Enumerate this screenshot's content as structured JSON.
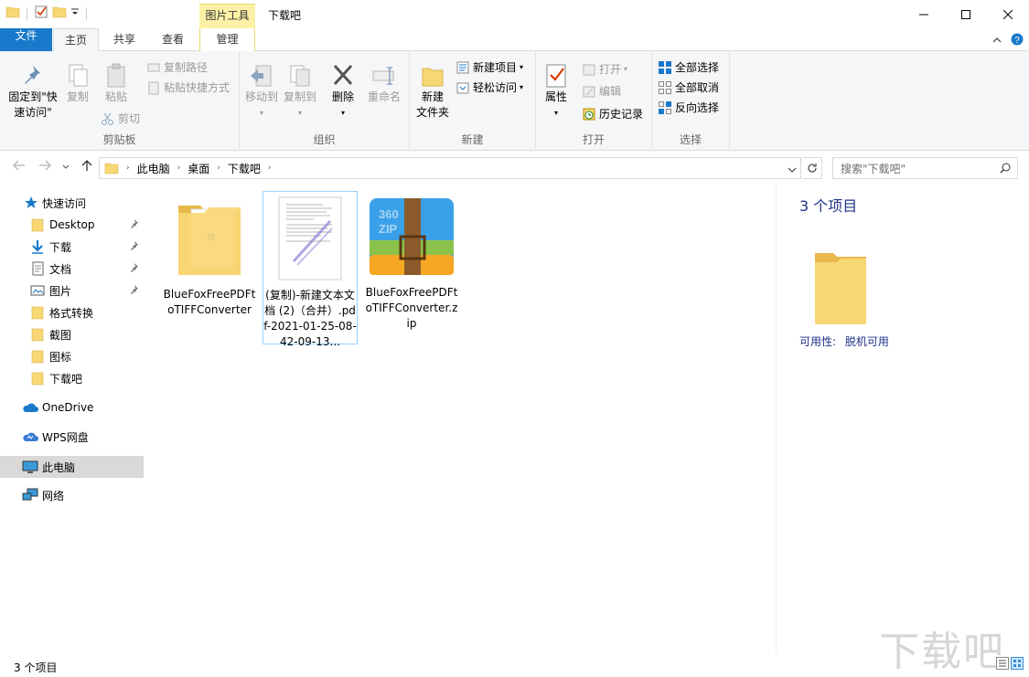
{
  "window": {
    "title": "下载吧",
    "contextual_tab_header": "图片工具"
  },
  "tabs": {
    "file": "文件",
    "home": "主页",
    "share": "共享",
    "view": "查看",
    "manage": "管理"
  },
  "ribbon": {
    "clipboard": {
      "label": "剪贴板",
      "pin": "固定到\"快\n速访问\"",
      "copy": "复制",
      "paste": "粘贴",
      "copy_path": "复制路径",
      "paste_shortcut": "粘贴快捷方式",
      "cut": "剪切"
    },
    "organize": {
      "label": "组织",
      "move_to": "移动到",
      "copy_to": "复制到",
      "delete": "删除",
      "rename": "重命名"
    },
    "new": {
      "label": "新建",
      "new_folder": "新建\n文件夹",
      "new_item": "新建项目",
      "easy_access": "轻松访问"
    },
    "open": {
      "label": "打开",
      "properties": "属性",
      "open": "打开",
      "edit": "编辑",
      "history": "历史记录"
    },
    "select": {
      "label": "选择",
      "select_all": "全部选择",
      "select_none": "全部取消",
      "invert": "反向选择"
    }
  },
  "address": {
    "crumbs": [
      "此电脑",
      "桌面",
      "下载吧"
    ],
    "search_placeholder": "搜索\"下载吧\""
  },
  "nav": {
    "quick_access": "快速访问",
    "items": [
      "Desktop",
      "下载",
      "文档",
      "图片",
      "格式转换",
      "截图",
      "图标",
      "下载吧"
    ],
    "onedrive": "OneDrive",
    "wps": "WPS网盘",
    "this_pc": "此电脑",
    "network": "网络"
  },
  "files": [
    {
      "name": "BlueFoxFreePDFtoTIFFConverter",
      "type": "folder"
    },
    {
      "name": "(复制)-新建文本文档 (2)（合并）.pdf-2021-01-25-08-42-09-13...",
      "type": "tiff"
    },
    {
      "name": "BlueFoxFreePDFtoTIFFConverter.zip",
      "type": "zip",
      "badge": "360\nZIP"
    }
  ],
  "details": {
    "count": "3 个项目",
    "availability_label": "可用性:",
    "availability_value": "脱机可用"
  },
  "status": {
    "count": "3 个项目",
    "watermark": "下载吧"
  },
  "colors": {
    "file_tab": "#1979ca",
    "context_tab": "#fcf1a7",
    "folder": "#f8d775"
  }
}
